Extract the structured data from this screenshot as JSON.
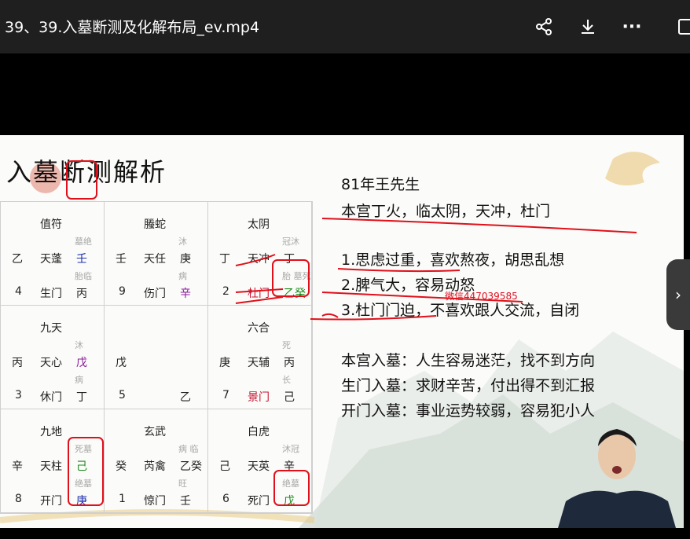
{
  "window": {
    "title": "39、39.入墓断测及化解布局_ev.mp4"
  },
  "toolbar": {
    "icons": [
      "share-icon",
      "download-icon",
      "more-icon",
      "save-icon"
    ],
    "more_label": "···"
  },
  "slide": {
    "title": "入墓断测解析",
    "grid": [
      {
        "top": "值符",
        "r1": [
          "乙",
          "天蓬",
          "壬"
        ],
        "r1sm": "墓绝",
        "r2sm": "胎临",
        "r2": [
          "4",
          "生门",
          "丙"
        ]
      },
      {
        "top": "螣蛇",
        "r1": [
          "壬",
          "天任",
          "庚"
        ],
        "r1sm": "沐",
        "r2sm": "病",
        "r2": [
          "9",
          "伤门",
          "辛"
        ]
      },
      {
        "top": "太阴",
        "r1": [
          "丁",
          "天冲",
          "丁"
        ],
        "r1sm": "冠沐",
        "r2sm": "胎 墓死",
        "r2": [
          "2",
          "杜门",
          "乙癸"
        ]
      },
      {
        "top": "九天",
        "r1": [
          "丙",
          "天心",
          "戊"
        ],
        "r1sm": "沐",
        "r2sm": "病",
        "r2": [
          "3",
          "休门",
          "丁"
        ]
      },
      {
        "top": "",
        "r1": [
          "戊",
          "",
          ""
        ],
        "r1sm": "",
        "r2sm": "",
        "r2": [
          "5",
          "",
          "乙"
        ]
      },
      {
        "top": "六合",
        "r1": [
          "庚",
          "天辅",
          "丙"
        ],
        "r1sm": "死",
        "r2sm": "长",
        "r2": [
          "7",
          "景门",
          "己"
        ]
      },
      {
        "top": "九地",
        "r1": [
          "辛",
          "天柱",
          "己"
        ],
        "r1sm": "死墓",
        "r2sm": "绝墓",
        "r2": [
          "8",
          "开门",
          "庚"
        ]
      },
      {
        "top": "玄武",
        "r1": [
          "癸",
          "芮禽",
          "乙癸"
        ],
        "r1sm": "病 临",
        "r2sm": "旺",
        "r2": [
          "1",
          "惊门",
          "壬"
        ]
      },
      {
        "top": "白虎",
        "r1": [
          "己",
          "天英",
          "辛"
        ],
        "r1sm": "沐冠",
        "r2sm": "绝墓",
        "r2": [
          "6",
          "死门",
          "戊"
        ]
      }
    ],
    "case_title": "81年王先生",
    "case_line": "本宫丁火，临太阴，天冲，杜门",
    "points": [
      "1.思虑过重，喜欢熬夜，胡思乱想",
      "2.脾气大，容易动怒",
      "3.杜门门迫，不喜欢跟人交流，自闭"
    ],
    "watermark": "微信447039585",
    "effects": [
      "本宫入墓：人生容易迷茫，找不到方向",
      "生门入墓：求财辛苦，付出得不到汇报",
      "开门入墓：事业运势较弱，容易犯小人"
    ]
  },
  "player": {
    "next_label": "›"
  },
  "colors": {
    "accent_red": "#e0101a",
    "slide_bg": "#fbfbf9"
  }
}
